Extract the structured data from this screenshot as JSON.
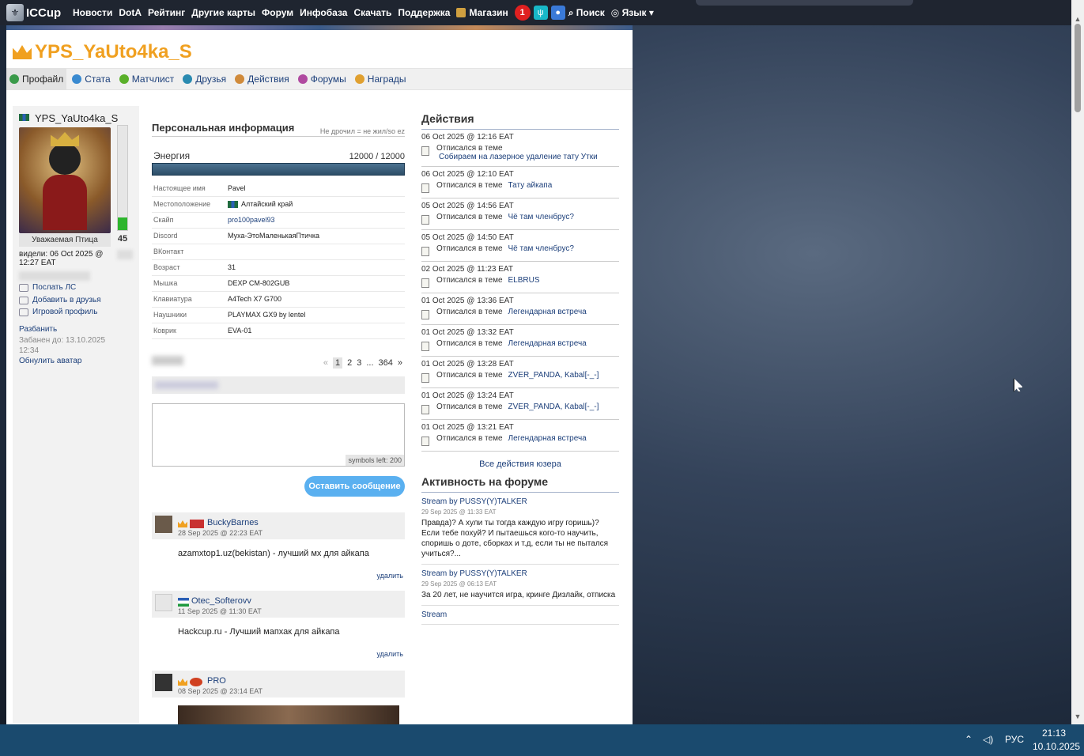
{
  "nav": {
    "logo": "ICCup",
    "items": [
      "Новости",
      "DotA",
      "Рейтинг",
      "Другие карты",
      "Форум",
      "Инфобаза",
      "Скачать",
      "Поддержка"
    ],
    "shop": "Магазин",
    "notif_count": "1",
    "search": "Поиск",
    "lang": "Язык"
  },
  "profile": {
    "name": "YPS_YaUto4ka_S",
    "tabs": [
      "Профайл",
      "Стата",
      "Матчлист",
      "Друзья",
      "Действия",
      "Форумы",
      "Награды"
    ],
    "rank": "Уважаемая Птица",
    "energy_level": "45",
    "energy_fraction": 0.12,
    "seen": "видели: 06 Oct 2025 @ 12:27 EAT",
    "links": [
      "Послать ЛС",
      "Добавить в друзья",
      "Игровой профиль"
    ],
    "unban": "Разбанить",
    "ban_until": "Забанен до: 13.10.2025 12:34",
    "reset_avatar": "Обнулить аватар"
  },
  "info": {
    "title": "Персональная информация",
    "note": "Не дрочил = не жил/so ez",
    "energy_label": "Энергия",
    "energy_value": "12000 / 12000",
    "rows": [
      {
        "k": "Настоящее имя",
        "v": "Pavel"
      },
      {
        "k": "Местоположение",
        "v": "Алтайский край"
      },
      {
        "k": "Скайп",
        "v": "pro100pavel93"
      },
      {
        "k": "Discord",
        "v": "Муха-ЭтоМаленькаяПтичка"
      },
      {
        "k": "ВКонтакт",
        "v": ""
      },
      {
        "k": "Возраст",
        "v": "31"
      },
      {
        "k": "Мышка",
        "v": "DEXP CM-802GUB"
      },
      {
        "k": "Клавиатура",
        "v": "A4Tech X7 G700"
      },
      {
        "k": "Наушники",
        "v": "PLAYMAX GX9 by lentel"
      },
      {
        "k": "Коврик",
        "v": "EVA-01"
      }
    ]
  },
  "wall": {
    "pager": {
      "prev": "«",
      "pages": [
        "1",
        "2",
        "3"
      ],
      "ellipsis": "...",
      "last": "364",
      "next": "»"
    },
    "symbols_left": "symbols left: 200",
    "send": "Оставить сообщение",
    "comments": [
      {
        "name": "BuckyBarnes",
        "date": "28 Sep 2025 @ 22:23 EAT",
        "text": "azamxtop1.uz(bekistan) - лучший мх для айкапа",
        "delete": "удалить"
      },
      {
        "name": "Otec_Softerovv",
        "date": "11 Sep 2025 @ 11:30 EAT",
        "text": "Hackcup.ru - Лучший мапхак для айкапа",
        "delete": "удалить"
      },
      {
        "name": "PRO",
        "date": "08 Sep 2025 @ 23:14 EAT"
      }
    ]
  },
  "actions": {
    "title": "Действия",
    "label": "Отписался в теме",
    "items": [
      {
        "date": "06 Oct 2025 @ 12:16 EAT",
        "topic": "Собираем на лазерное удаление тату Утки"
      },
      {
        "date": "06 Oct 2025 @ 12:10 EAT",
        "topic": "Тату айкапа"
      },
      {
        "date": "05 Oct 2025 @ 14:56 EAT",
        "topic": "Чё там членбрус?"
      },
      {
        "date": "05 Oct 2025 @ 14:50 EAT",
        "topic": "Чё там членбрус?"
      },
      {
        "date": "02 Oct 2025 @ 11:23 EAT",
        "topic": "ELBRUS"
      },
      {
        "date": "01 Oct 2025 @ 13:36 EAT",
        "topic": "Легендарная встреча"
      },
      {
        "date": "01 Oct 2025 @ 13:32 EAT",
        "topic": "Легендарная встреча"
      },
      {
        "date": "01 Oct 2025 @ 13:28 EAT",
        "topic": "ZVER_PANDA, Kabal[-_-]"
      },
      {
        "date": "01 Oct 2025 @ 13:24 EAT",
        "topic": "ZVER_PANDA, Kabal[-_-]"
      },
      {
        "date": "01 Oct 2025 @ 13:21 EAT",
        "topic": "Легендарная встреча"
      }
    ],
    "all": "Все действия юзера"
  },
  "forum": {
    "title": "Активность на форуме",
    "items": [
      {
        "title": "Stream by PUSSY(Y)TALKER",
        "date": "29 Sep 2025 @ 11:33 EAT",
        "text": "Правда)? А хули ты тогда каждую игру горишь)? Если тебе похуй? И пытаешься кого-то научить, споришь о доте, сборках и т.д, если ты не пытался учиться?..."
      },
      {
        "title": "Stream by PUSSY(Y)TALKER",
        "date": "29 Sep 2025 @ 06:13 EAT",
        "text": "За 20 лет, не научится игра, кринге Дизлайк, отписка"
      },
      {
        "title": "Stream",
        "date": "",
        "text": ""
      }
    ]
  },
  "taskbar": {
    "lang": "РУС",
    "time": "21:13",
    "date": "10.10.2025"
  }
}
